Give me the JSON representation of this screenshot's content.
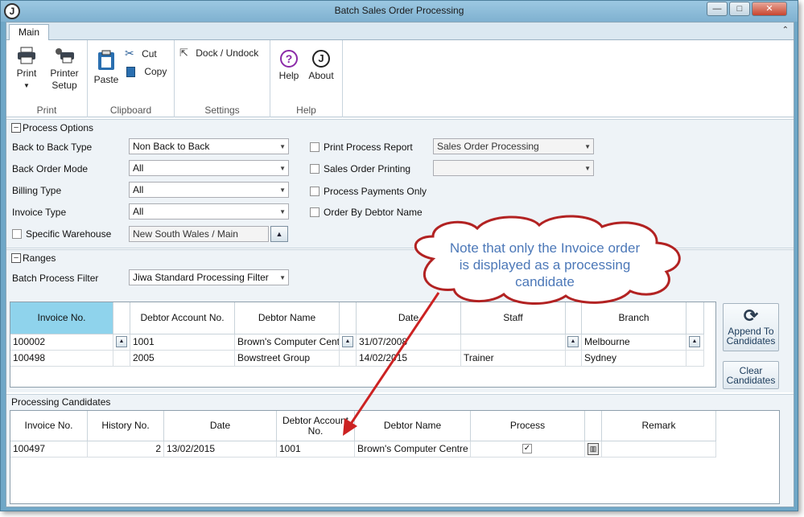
{
  "window": {
    "title": "Batch Sales Order Processing",
    "app_icon": "J",
    "min": "—",
    "max": "□",
    "close": "✕"
  },
  "ribbon": {
    "tab": "Main",
    "groups": {
      "print": {
        "label": "Print",
        "print": "Print",
        "printer_setup_1": "Printer",
        "printer_setup_2": "Setup"
      },
      "clipboard": {
        "label": "Clipboard",
        "paste": "Paste",
        "cut": "Cut",
        "copy": "Copy"
      },
      "settings": {
        "label": "Settings",
        "dock": "Dock / Undock"
      },
      "help": {
        "label": "Help",
        "help": "Help",
        "about": "About"
      }
    }
  },
  "process_options": {
    "title": "Process Options",
    "back_to_back_type": {
      "label": "Back to Back Type",
      "value": "Non Back to Back"
    },
    "back_order_mode": {
      "label": "Back Order Mode",
      "value": "All"
    },
    "billing_type": {
      "label": "Billing Type",
      "value": "All"
    },
    "invoice_type": {
      "label": "Invoice Type",
      "value": "All"
    },
    "specific_warehouse": {
      "label": "Specific Warehouse",
      "value": "New South Wales / Main"
    },
    "print_process_report": {
      "label": "Print Process Report",
      "value": "Sales Order Processing"
    },
    "sales_order_printing": {
      "label": "Sales Order Printing",
      "value": ""
    },
    "process_payments_only": {
      "label": "Process Payments Only"
    },
    "order_by_debtor_name": {
      "label": "Order By Debtor Name"
    }
  },
  "ranges": {
    "title": "Ranges",
    "batch_process_filter": {
      "label": "Batch Process Filter",
      "value": "Jiwa Standard Processing Filter"
    },
    "columns": [
      "Invoice No.",
      "Debtor Account No.",
      "Debtor Name",
      "Date",
      "Staff",
      "Branch"
    ],
    "rows": [
      {
        "invoice": "100002",
        "debtor_account": "1001",
        "debtor_name": "Brown's Computer Centre",
        "date": "31/07/2008",
        "staff": "",
        "branch": "Melbourne"
      },
      {
        "invoice": "100498",
        "debtor_account": "2005",
        "debtor_name": "Bowstreet Group",
        "date": "14/02/2015",
        "staff": "Trainer",
        "branch": "Sydney"
      }
    ],
    "append_1": "Append To",
    "append_2": "Candidates",
    "clear_1": "Clear",
    "clear_2": "Candidates"
  },
  "candidates": {
    "title": "Processing Candidates",
    "columns": [
      "Invoice No.",
      "History No.",
      "Date",
      "Debtor Account No.",
      "Debtor Name",
      "Process",
      "Remark"
    ],
    "rows": [
      {
        "invoice": "100497",
        "history": "2",
        "date": "13/02/2015",
        "debtor_account": "1001",
        "debtor_name": "Brown's Computer Centre",
        "process": true,
        "remark": ""
      }
    ]
  },
  "callout": {
    "text": "Note that only the Invoice order is displayed as a processing candidate"
  },
  "colors": {
    "title_bar": "#7fb1d0",
    "selected_header": "#8fd3ec",
    "callout_border": "#b22222",
    "callout_text": "#4c78b8",
    "arrow": "#cc2222"
  }
}
